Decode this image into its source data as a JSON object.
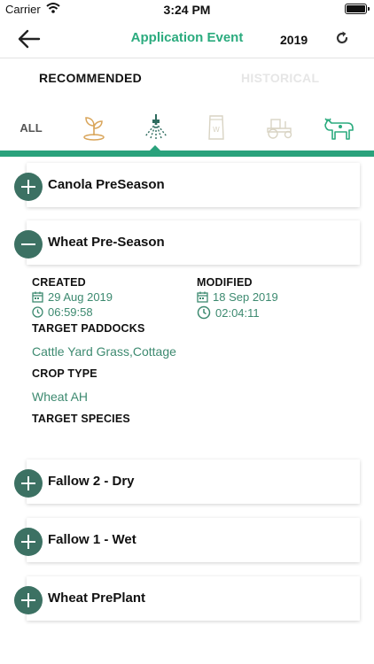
{
  "status_bar": {
    "carrier": "Carrier",
    "time": "3:24 PM"
  },
  "nav": {
    "title": "Application Event",
    "year": "2019"
  },
  "tabs": [
    {
      "label": "RECOMMENDED",
      "active": true
    },
    {
      "label": "HISTORICAL",
      "active": false
    }
  ],
  "filters": {
    "all_label": "ALL",
    "icons": [
      "seedling-icon",
      "sprayer-icon",
      "fertilizer-bag-icon",
      "tractor-icon",
      "cow-icon"
    ],
    "selected": "sprayer-icon"
  },
  "events": [
    {
      "title": "Canola PreSeason",
      "expanded": false
    },
    {
      "title": "Wheat Pre-Season",
      "expanded": true,
      "created_label": "CREATED",
      "created_date": "29 Aug 2019",
      "created_time": "06:59:58",
      "modified_label": "MODIFIED",
      "modified_date": "18 Sep 2019",
      "modified_time": "02:04:11",
      "target_paddocks_label": "TARGET PADDOCKS",
      "target_paddocks": "Cattle Yard Grass,Cottage",
      "crop_type_label": "CROP TYPE",
      "crop_type": "Wheat AH",
      "target_species_label": "TARGET SPECIES",
      "target_species": ""
    },
    {
      "title": "Fallow 2 - Dry",
      "expanded": false
    },
    {
      "title": "Fallow 1 - Wet",
      "expanded": false
    },
    {
      "title": "Wheat PrePlant",
      "expanded": false
    }
  ],
  "colors": {
    "accent": "#2bab7e",
    "strip": "#2aa27c",
    "button": "#3c7163",
    "value_text": "#3d8a70",
    "icon_muted": "#d9d4c4",
    "icon_gold": "#d9a55a"
  }
}
